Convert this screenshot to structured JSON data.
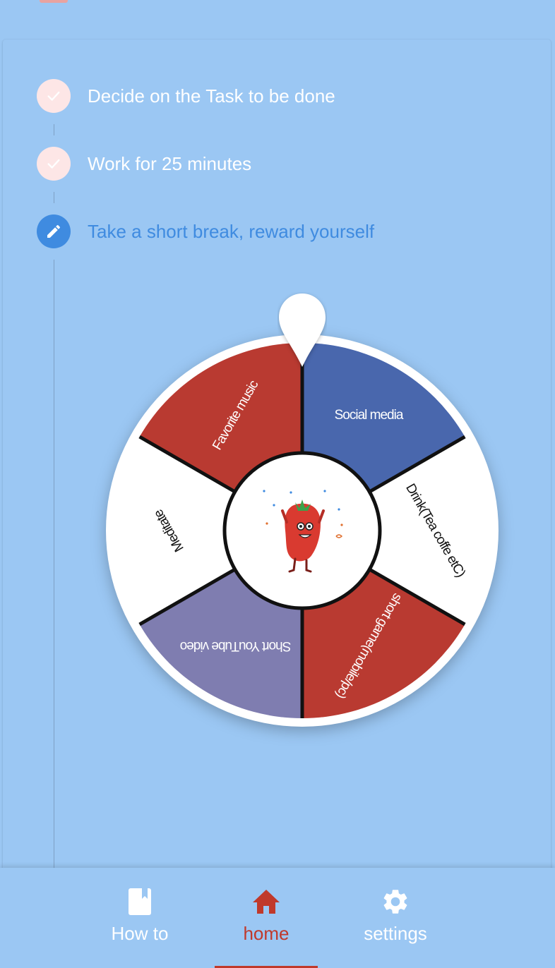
{
  "steps": [
    {
      "label": "Decide on the Task to be done",
      "state": "done",
      "icon": "check-icon"
    },
    {
      "label": "Work for 25 minutes",
      "state": "done",
      "icon": "check-icon"
    },
    {
      "label": "Take a short break, reward yourself",
      "state": "active",
      "icon": "pencil-icon"
    }
  ],
  "wheel": {
    "segments": [
      {
        "label": "Social media",
        "color": "#4967ad",
        "text_color": "#ffffff"
      },
      {
        "label": "Drink(Tea coffe etC)",
        "color": "#ffffff",
        "text_color": "#111111"
      },
      {
        "label": "short game(mobile/pc)",
        "color": "#b93a31",
        "text_color": "#ffffff"
      },
      {
        "label": "Short YouTube video",
        "color": "#7f7db0",
        "text_color": "#ffffff"
      },
      {
        "label": "Meditate",
        "color": "#ffffff",
        "text_color": "#111111"
      },
      {
        "label": "Favorite music",
        "color": "#b93a31",
        "text_color": "#ffffff"
      }
    ],
    "center_image": "strawberry-mascot"
  },
  "nav": {
    "items": [
      {
        "label": "How to",
        "icon": "book-icon",
        "active": false
      },
      {
        "label": "home",
        "icon": "home-icon",
        "active": true
      },
      {
        "label": "settings",
        "icon": "gear-icon",
        "active": false
      }
    ]
  },
  "colors": {
    "background": "#9bc7f3",
    "accent_blue": "#3f8be0",
    "accent_red": "#c0392b",
    "done_circle": "#fde6e6"
  }
}
